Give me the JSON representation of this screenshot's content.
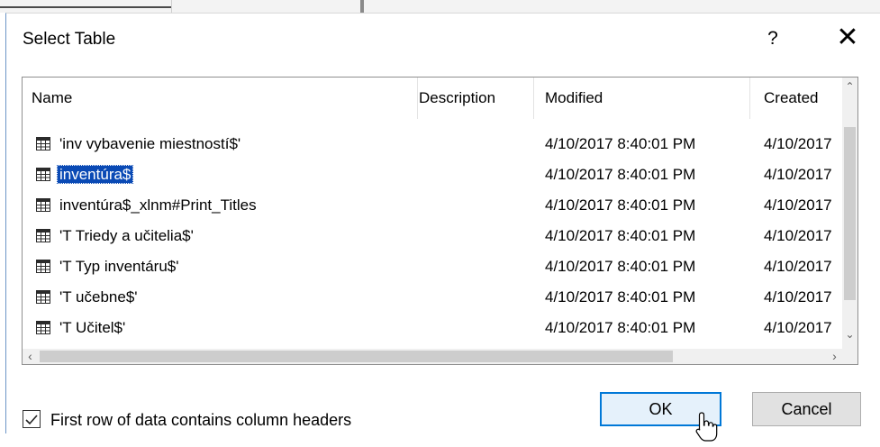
{
  "dialog": {
    "title": "Select Table",
    "help_label": "?",
    "close_label": "✕"
  },
  "columns": {
    "name": "Name",
    "description": "Description",
    "modified": "Modified",
    "created": "Created"
  },
  "rows": [
    {
      "name": "'inv vybavenie miestností$'",
      "description": "",
      "modified": "4/10/2017 8:40:01 PM",
      "created": "4/10/2017"
    },
    {
      "name": "inventúra$",
      "description": "",
      "modified": "4/10/2017 8:40:01 PM",
      "created": "4/10/2017"
    },
    {
      "name": "inventúra$_xlnm#Print_Titles",
      "description": "",
      "modified": "4/10/2017 8:40:01 PM",
      "created": "4/10/2017"
    },
    {
      "name": "'T Triedy a učitelia$'",
      "description": "",
      "modified": "4/10/2017 8:40:01 PM",
      "created": "4/10/2017"
    },
    {
      "name": "'T Typ inventáru$'",
      "description": "",
      "modified": "4/10/2017 8:40:01 PM",
      "created": "4/10/2017"
    },
    {
      "name": "'T učebne$'",
      "description": "",
      "modified": "4/10/2017 8:40:01 PM",
      "created": "4/10/2017"
    },
    {
      "name": "'T Učitel$'",
      "description": "",
      "modified": "4/10/2017 8:40:01 PM",
      "created": "4/10/2017"
    }
  ],
  "selected_row": "inventúra$",
  "icons": {
    "row_icon": "table-icon",
    "scroll_up": "chevron-up-icon",
    "scroll_down": "chevron-down-icon",
    "scroll_left": "chevron-left-icon",
    "scroll_right": "chevron-right-icon"
  },
  "footer": {
    "checkbox_label": "First row of data contains column headers",
    "checkbox_checked": true,
    "ok_label": "OK",
    "cancel_label": "Cancel"
  },
  "colors": {
    "selection": "#0a4ab5",
    "ok_border": "#0078d7",
    "ok_fill": "#e5f1fb"
  }
}
